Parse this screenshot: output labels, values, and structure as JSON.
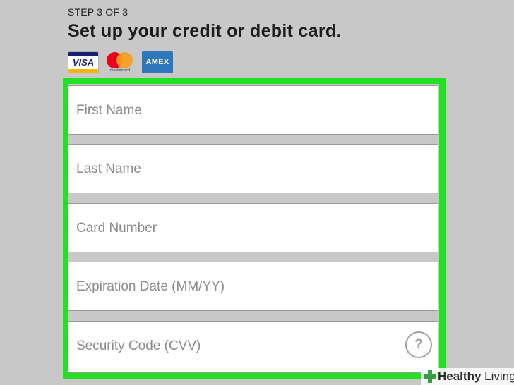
{
  "step_indicator": "STEP 3 OF 3",
  "page_title": "Set up your credit or debit card.",
  "card_logos": {
    "visa": "VISA",
    "mastercard": "mastercard",
    "amex": "AMEX"
  },
  "form": {
    "first_name_placeholder": "First Name",
    "last_name_placeholder": "Last Name",
    "card_number_placeholder": "Card Number",
    "expiration_placeholder": "Expiration Date (MM/YY)",
    "security_code_placeholder": "Security Code (CVV)",
    "help_icon_glyph": "?"
  },
  "watermark": {
    "brand_bold": "Healthy",
    "brand_light": " Living"
  },
  "colors": {
    "background": "#c8c8c8",
    "highlight": "#22e022",
    "visa_blue": "#1a1f71",
    "amex_blue": "#2e77bc",
    "mastercard_red": "#eb001b",
    "mastercard_orange": "#f79e1b"
  }
}
